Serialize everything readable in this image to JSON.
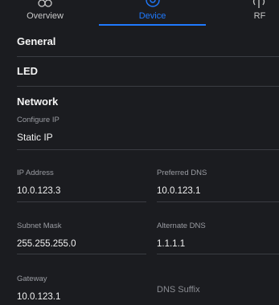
{
  "tabs": {
    "overview": "Overview",
    "device": "Device",
    "rf": "RF"
  },
  "sections": {
    "general": "General",
    "led": "LED",
    "network": "Network"
  },
  "network": {
    "configure_ip_label": "Configure IP",
    "configure_ip_value": "Static IP",
    "ip_address_label": "IP Address",
    "ip_address_value": "10.0.123.3",
    "preferred_dns_label": "Preferred DNS",
    "preferred_dns_value": "10.0.123.1",
    "subnet_mask_label": "Subnet Mask",
    "subnet_mask_value": "255.255.255.0",
    "alternate_dns_label": "Alternate DNS",
    "alternate_dns_value": "1.1.1.1",
    "gateway_label": "Gateway",
    "gateway_value": "10.0.123.1",
    "dns_suffix_label": "DNS Suffix"
  },
  "colors": {
    "accent": "#1f7aff",
    "background": "#1b1c20",
    "divider": "#3b3d43"
  }
}
